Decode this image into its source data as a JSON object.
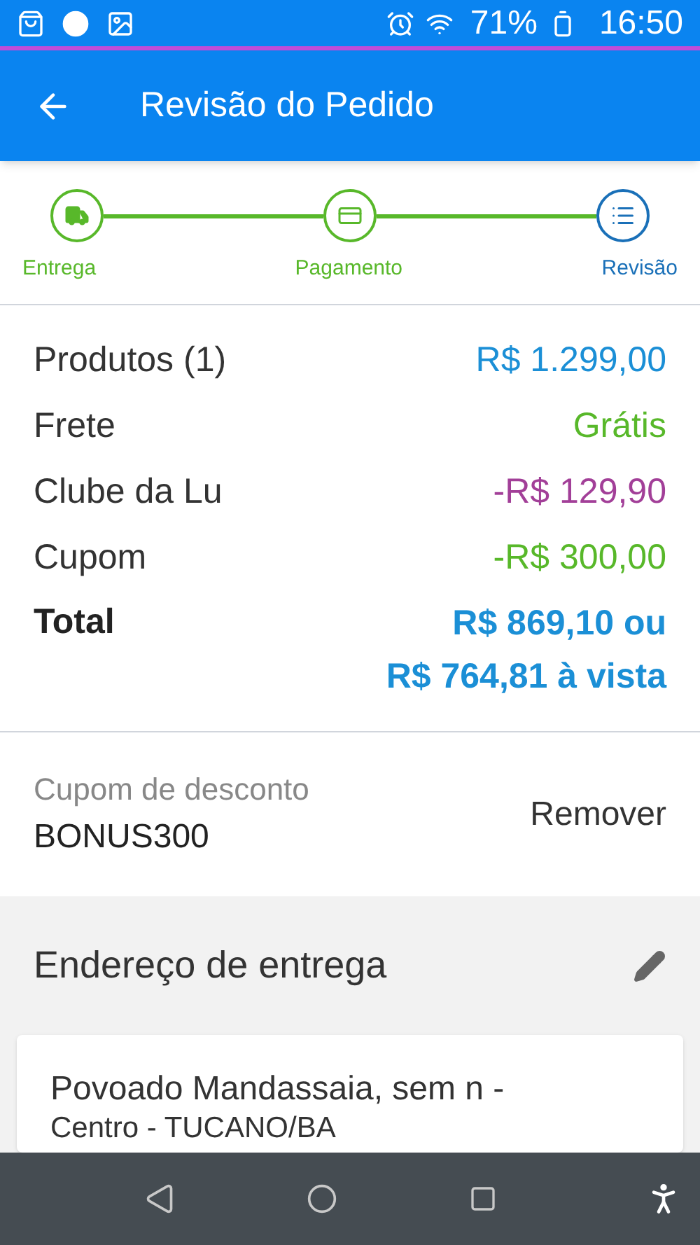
{
  "status_bar": {
    "battery": "71%",
    "time": "16:50"
  },
  "app_bar": {
    "title": "Revisão do Pedido"
  },
  "steps": [
    {
      "label": "Entrega",
      "kind": "truck",
      "selected": false
    },
    {
      "label": "Pagamento",
      "kind": "card",
      "selected": false
    },
    {
      "label": "Revisão",
      "kind": "list",
      "selected": true
    }
  ],
  "summary": [
    {
      "label": "Produtos (1)",
      "value": "R$ 1.299,00",
      "color": "#1b8fd6"
    },
    {
      "label": "Frete",
      "value": "Grátis",
      "color": "#58b82a"
    },
    {
      "label": "Clube da Lu",
      "value": "-R$ 129,90",
      "color": "#a23f98"
    },
    {
      "label": "Cupom",
      "value": "-R$ 300,00",
      "color": "#58b82a"
    }
  ],
  "total": {
    "label": "Total",
    "value": "R$ 869,10 ou",
    "value_cash": "R$ 764,81 à vista"
  },
  "coupon": {
    "label": "Cupom de desconto",
    "code": "BONUS300",
    "remove": "Remover"
  },
  "address": {
    "title": "Endereço de entrega",
    "line_1": "Povoado Mandassaia, sem n -",
    "line_2": "Centro - TUCANO/BA"
  }
}
